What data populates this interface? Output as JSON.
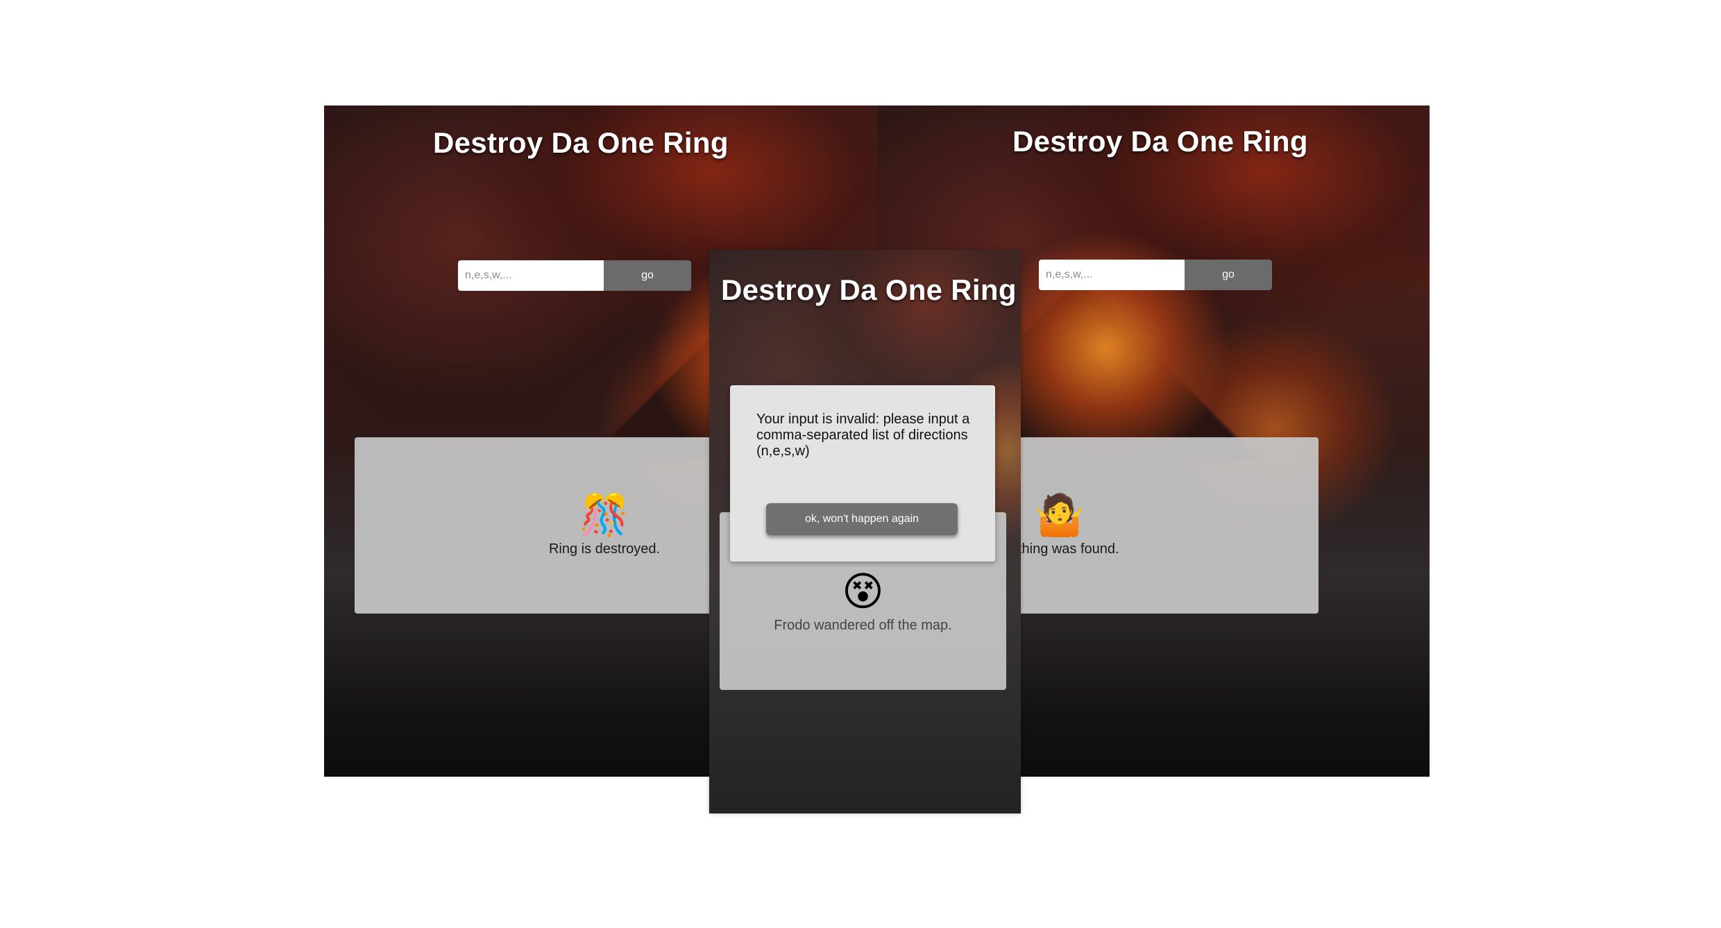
{
  "screens": {
    "left": {
      "title": "Destroy Da One Ring",
      "input_placeholder": "n,e,s,w,...",
      "go_label": "go",
      "result_emoji": "🎊",
      "result_text": "Ring is destroyed."
    },
    "right": {
      "title": "Destroy Da One Ring",
      "input_placeholder": "n,e,s,w,...",
      "go_label": "go",
      "result_emoji": "🤷",
      "result_text": "Nothing was found."
    },
    "middle": {
      "title": "Destroy Da One Ring",
      "result_emoji": "😵",
      "result_text": "Frodo wandered off the map.",
      "modal": {
        "message": "Your input is invalid: please input a comma-separated list of directions (n,e,s,w)",
        "button_label": "ok, won't happen again"
      }
    }
  },
  "colors": {
    "go_button": "#6b6b6b",
    "result_card": "#c8c8c8",
    "modal_bg": "#e3e3e3",
    "modal_button": "#707070",
    "title_text": "#ffffff"
  }
}
